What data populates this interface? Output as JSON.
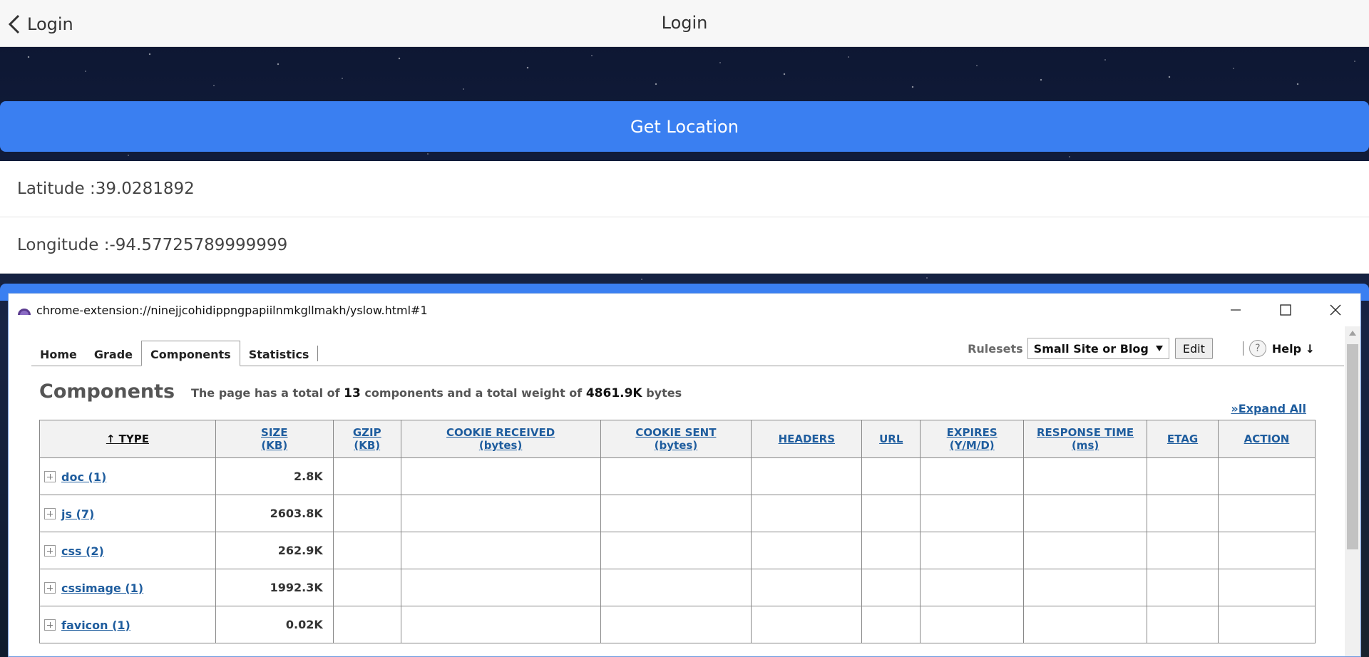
{
  "app": {
    "back_label": "Login",
    "title": "Login",
    "get_location_label": "Get Location",
    "latitude": "Latitude :39.0281892",
    "longitude": "Longitude :-94.57725789999999"
  },
  "popup": {
    "url": "chrome-extension://ninejjcohidippngpapiilnmkgllmakh/yslow.html#1",
    "tabs": [
      "Home",
      "Grade",
      "Components",
      "Statistics"
    ],
    "active_tab": "Components",
    "rulesets_label": "Rulesets",
    "ruleset_selected": "Small Site or Blog",
    "edit_label": "Edit",
    "help_label": "Help ↓",
    "heading": "Components",
    "summary_prefix": "The page has a total of",
    "total_components": "13",
    "summary_middle": "components and a total weight of",
    "total_weight": "4861.9K",
    "summary_suffix": "bytes",
    "expand_all": "»Expand All",
    "columns": [
      "↑ TYPE",
      "SIZE (KB)",
      "GZIP (KB)",
      "COOKIE RECEIVED (bytes)",
      "COOKIE SENT (bytes)",
      "HEADERS",
      "URL",
      "EXPIRES (Y/M/D)",
      "RESPONSE TIME (ms)",
      "ETAG",
      "ACTION"
    ],
    "rows": [
      {
        "type": "doc (1)",
        "size": "2.8K"
      },
      {
        "type": "js (7)",
        "size": "2603.8K"
      },
      {
        "type": "css (2)",
        "size": "262.9K"
      },
      {
        "type": "cssimage (1)",
        "size": "1992.3K"
      },
      {
        "type": "favicon (1)",
        "size": "0.02K"
      }
    ]
  },
  "colors": {
    "primary_button": "#3a7ff1",
    "link": "#1f5d9e"
  }
}
